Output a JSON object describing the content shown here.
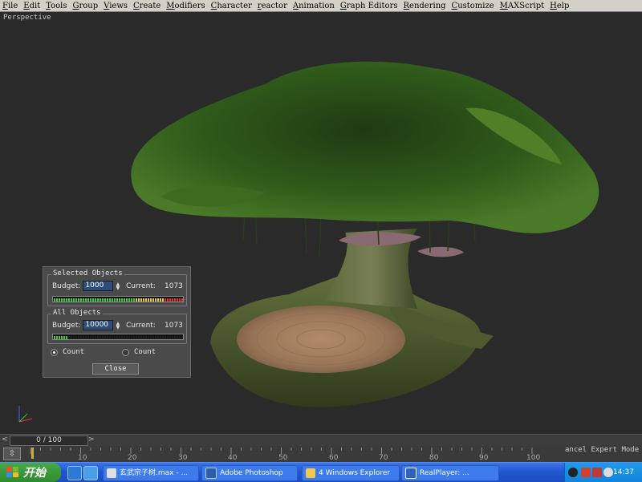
{
  "menu": [
    "File",
    "Edit",
    "Tools",
    "Group",
    "Views",
    "Create",
    "Modifiers",
    "Character",
    "reactor",
    "Animation",
    "Graph Editors",
    "Rendering",
    "Customize",
    "MAXScript",
    "Help"
  ],
  "viewport": {
    "label": "Perspective"
  },
  "stats_dialog": {
    "selected": {
      "title": "Selected Objects",
      "budget_label": "Budget:",
      "budget_value": "1000",
      "current_label": "Current:",
      "current_value": "1073",
      "meter_fraction": 1.0
    },
    "all": {
      "title": "All Objects",
      "budget_label": "Budget:",
      "budget_value": "10000",
      "current_label": "Current:",
      "current_value": "1073",
      "meter_fraction": 0.11
    },
    "radio_count_1": "Count",
    "radio_count_2": "Count",
    "close_label": "Close"
  },
  "timeslider": {
    "frame_text": "0 / 100",
    "prev_icon": "chevron-left-icon",
    "next_icon": "chevron-right-icon"
  },
  "trackbar": {
    "ruler_labels": [
      "10",
      "20",
      "30",
      "40",
      "50",
      "60",
      "70",
      "80",
      "90",
      "100"
    ],
    "mode_text": "ancel Expert Mode"
  },
  "taskbar": {
    "start_label": "开始",
    "tasks": [
      "玄武宗子树.max - ...",
      "Adobe Photoshop",
      "4 Windows Explorer",
      "RealPlayer: ..."
    ],
    "clock": "14:37"
  },
  "colors": {
    "taskbar_blue": "#2157d1",
    "start_green": "#3a9a3a",
    "budget_field": "#2c4d7a"
  }
}
